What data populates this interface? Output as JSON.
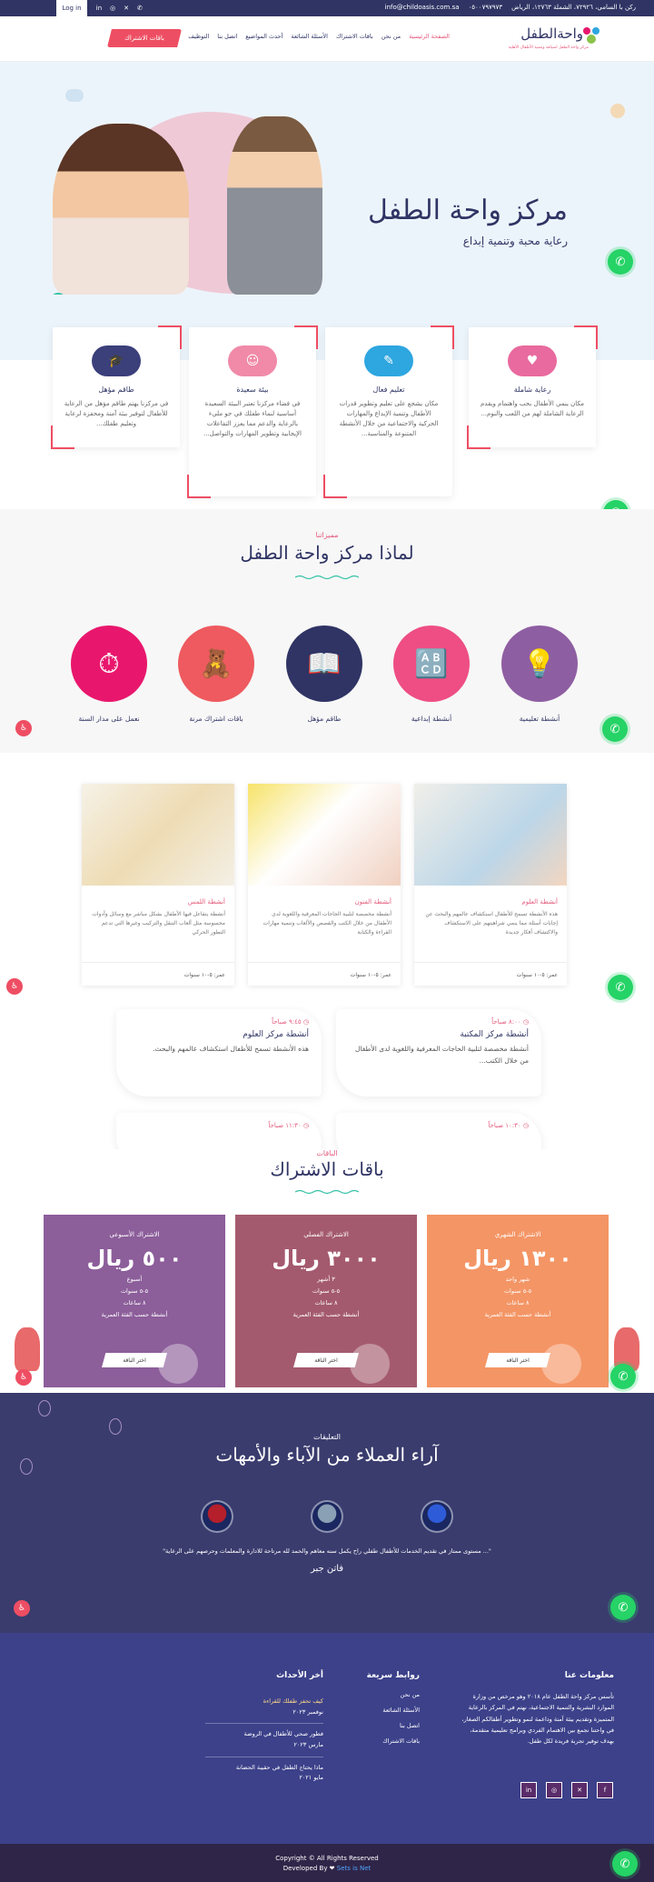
{
  "topbar": {
    "login": "Log in",
    "email": "info@childoasis.com.sa",
    "phone": "٠٥٠٠٧٩٧٩٧٣",
    "address": "ركن با السامي، ٧٢٩٢٦، الشملة ١٢٧٦٣، الرياض"
  },
  "nav": {
    "logo_title": "واحةالطفل",
    "logo_sub": "مركز واحة الطفل لضيافة وتنمية الأطفال الأهلية",
    "subscribe": "باقات الاشتراك",
    "items": [
      "الصفحة الرئيسية",
      "من نحن",
      "باقات الاشتراك",
      "الأسئلة الشائعة",
      "أحدث المواضيع",
      "اتصل بنا",
      "التوظيف"
    ]
  },
  "hero": {
    "title": "مركز واحة الطفل",
    "subtitle": "رعاية محبة وتنمية إبداع"
  },
  "features": [
    {
      "title": "رعاية شاملة",
      "text": "مكان ينمي الأطفال بحب واهتمام ويقدم الرعاية الشاملة لهم من اللعب والنوم...",
      "color": "#e86a9e"
    },
    {
      "title": "تعليم فعال",
      "text": "مكان يشجع على تعليم وتطوير قدرات الأطفال وتنمية الإبداع والمهارات الحركية والاجتماعية من خلال الأنشطة المتنوعة والمناسبة...",
      "color": "#2ea6df"
    },
    {
      "title": "بيئة سعيدة",
      "text": "في فضاء مركزنا تعتبر البيئة السعيدة أساسية لنماء طفلك في جو مليء بالرعاية والدعم مما يعزز التفاعلات الإيجابية وتطوير المهارات والتواصل...",
      "color": "#f08aa8"
    },
    {
      "title": "طاقم مؤهل",
      "text": "في مركزنا يهتم طاقم مؤهل من الرعاية للأطفال لتوفير بيئة آمنة ومحفزة لرعاية وتعليم طفلك...",
      "color": "#3b3f7a"
    }
  ],
  "why": {
    "eyebrow": "مميزاتنا",
    "title": "لماذا مركز واحة الطفل",
    "items": [
      {
        "label": "أنشطة تعليمية",
        "color": "#8e5ea2",
        "icon": "lightbulb-icon",
        "glyph": "💡"
      },
      {
        "label": "أنشطة إبداعية",
        "color": "#ee4e83",
        "icon": "abc-blocks-icon",
        "glyph": "🔠"
      },
      {
        "label": "طاقم مؤهل",
        "color": "#2f3464",
        "icon": "teacher-icon",
        "glyph": "👩‍🏫"
      },
      {
        "label": "باقات اشتراك مرنة",
        "color": "#ee5a5f",
        "icon": "teddy-bear-icon",
        "glyph": "🧸"
      },
      {
        "label": "نعمل على مدار السنة",
        "color": "#e8176d",
        "icon": "stopwatch-icon",
        "glyph": "⏱"
      }
    ]
  },
  "activities": [
    {
      "title": "أنشطة العلوم",
      "text": "هذه الأنشطة تسمح للأطفال استكشاف عالمهم والبحث عن إجابات أسئلة مما ينمي شراهيتهم على الاستكشاف والاكتشاف أفكار جديدة",
      "age": "عمر: ٥-١٠ سنوات"
    },
    {
      "title": "أنشطة الفنون",
      "text": "أنشطة مخصصة لتلبية الحاجات المعرفية واللغوية لدى الأطفال من خلال الكتب والقصص والألعاب وتنمية مهارات القراءة والكتابة",
      "age": "عمر: ٥-١٠ سنوات"
    },
    {
      "title": "أنشطة اللمس",
      "text": "أنشطة يتفاعل فيها الأطفال بشكل مباشر مع وسائل وأدوات محسوسة مثل ألعاب التنقل والتركيب وغيرها التي تدعم التطور الحركي",
      "age": "عمر: ٥-١٠ سنوات"
    }
  ],
  "schedule": [
    {
      "time": "٨:٠٠ صباحاً",
      "title": "أنشطة مركز المكتبة",
      "text": "أنشطة مخصصة لتلبية الحاجات المعرفية واللغوية لدى الأطفال من خلال الكتب..."
    },
    {
      "time": "٩:٤٥ صباحاً",
      "title": "أنشطة مركز العلوم",
      "text": "هذه الأنشطة تسمح للأطفال استكشاف عالمهم والبحث."
    },
    {
      "time": "١٠:٣٠ صباحاً",
      "title": "",
      "text": ""
    },
    {
      "time": "١١:٣٠ صباحاً",
      "title": "",
      "text": ""
    }
  ],
  "pricing": {
    "eyebrow": "الباقات",
    "title": "باقات الاشتراك",
    "plans": [
      {
        "name": "الاشتراك الشهري",
        "price": "١٣٠٠ ريال",
        "period": "شهر واحد",
        "ages": "٥-٥ سنوات",
        "hours": "٨ ساعات",
        "extra": "أنشطة حسب الفئة العمرية",
        "cta": "اختر الباقة",
        "color": "#f49565"
      },
      {
        "name": "الاشتراك الفصلي",
        "price": "٣٠٠٠ ريال",
        "period": "٣ أشهر",
        "ages": "٥-٥ سنوات",
        "hours": "٨ ساعات",
        "extra": "أنشطة حسب الفئة العمرية",
        "cta": "اختر الباقة",
        "color": "#a45a6e"
      },
      {
        "name": "الاشتراك الأسبوعي",
        "price": "٥٠٠ ريال",
        "period": "أسبوع",
        "ages": "٥-٥ سنوات",
        "hours": "٨ ساعات",
        "extra": "أنشطة حسب الفئة العمرية",
        "cta": "اختر الباقة",
        "color": "#8c5e9a"
      }
    ]
  },
  "testimonials": {
    "eyebrow": "التعليقات",
    "title": "آراء العملاء من الآباء والأمهات",
    "quote": "\"... مستوى ممتاز في تقديم الخدمات للأطفال طفلي راح يكمل سنه معاهم والحمد لله مرتاحة للادارة والمعلمات وحرصهم على الرعاية\"",
    "author": "فاتن جبر"
  },
  "footer": {
    "about_title": "معلومات عنا",
    "about_text": "تأسس مركز واحة الطفل عام ٢٠١٨ وهو مرخص من وزارة الموارد البشرية والتنمية الاجتماعية، نهتم في المركز بالرعاية المتميزة وتقديم بيئة آمنة وداعمة لنمو وتطوير أطفالكم الصغار، في واحتنا نجمع بين الاهتمام الفردي وبرامج تعليمية متقدمة، بهدف توفير تجربة فريدة لكل طفل.",
    "links_title": "روابط سريعة",
    "links": [
      "من نحن",
      "الأسئلة الشائعة",
      "اتصل بنا",
      "باقات الاشتراك"
    ],
    "news_title": "أخر الأحداث",
    "news": [
      {
        "title": "كيف تحفز طفلك للقراءة",
        "date": "نوفمبر ٢٠٢٣"
      },
      {
        "title": "فطور صحي للأطفال في الروضة",
        "date": "مارس ٢٠٢٣"
      },
      {
        "title": "ماذا يحتاج الطفل في حقيبة الحضانة",
        "date": "مايو ٢٠٢١"
      }
    ]
  },
  "bottom": {
    "copyright": "Copyright © All Rights Reserved",
    "dev": "Developed By ❤",
    "dev_name": "Sets is Net"
  },
  "colors": {
    "navy": "#2f3464",
    "pink": "#e45b7c",
    "red": "#ee4e63",
    "whatsapp": "#25d366"
  }
}
